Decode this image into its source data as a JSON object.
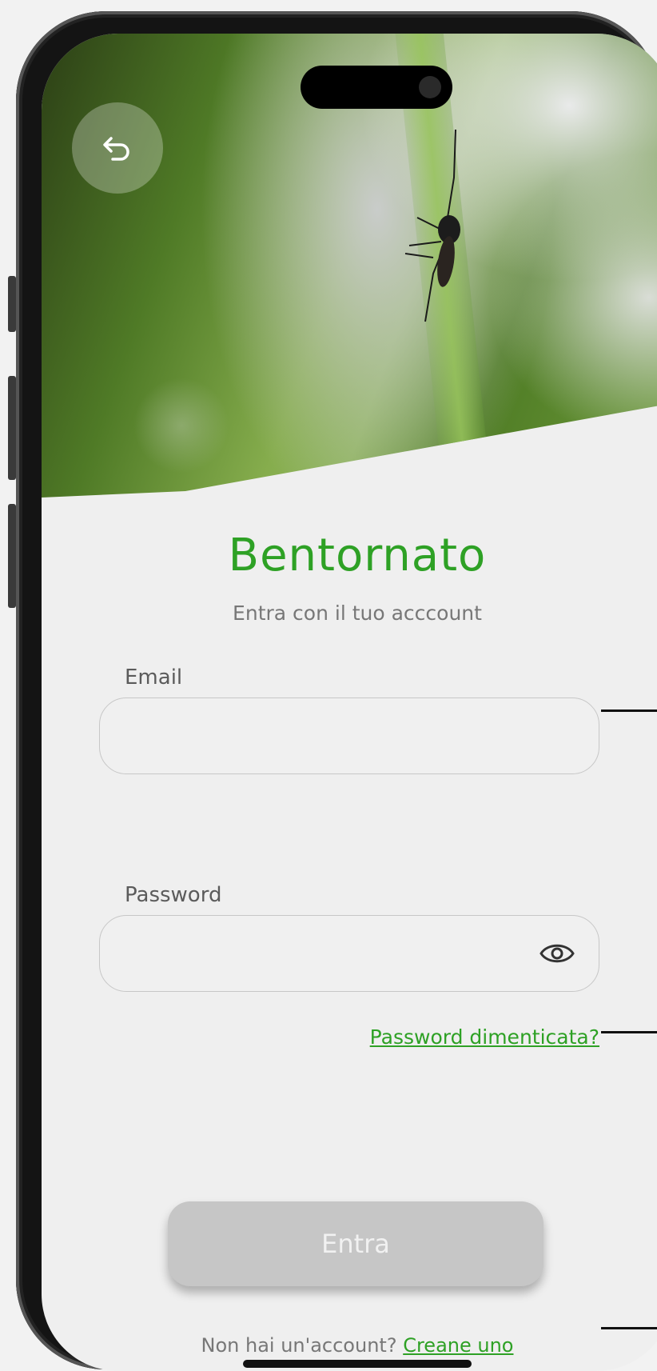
{
  "header": {
    "back_icon": "undo-arrow-icon"
  },
  "welcome": {
    "title": "Bentornato",
    "subtitle": "Entra con il tuo acccount"
  },
  "form": {
    "email_label": "Email",
    "email_value": "",
    "password_label": "Password",
    "password_value": "",
    "password_toggle_icon": "eye-icon",
    "forgot_link": "Password dimenticata?"
  },
  "actions": {
    "login_button": "Entra"
  },
  "footer": {
    "signup_prompt": "Non hai un'account?",
    "signup_link": "Creane uno"
  },
  "colors": {
    "accent": "#2ea125",
    "button_disabled": "#c6c6c6",
    "background": "#efefef"
  }
}
